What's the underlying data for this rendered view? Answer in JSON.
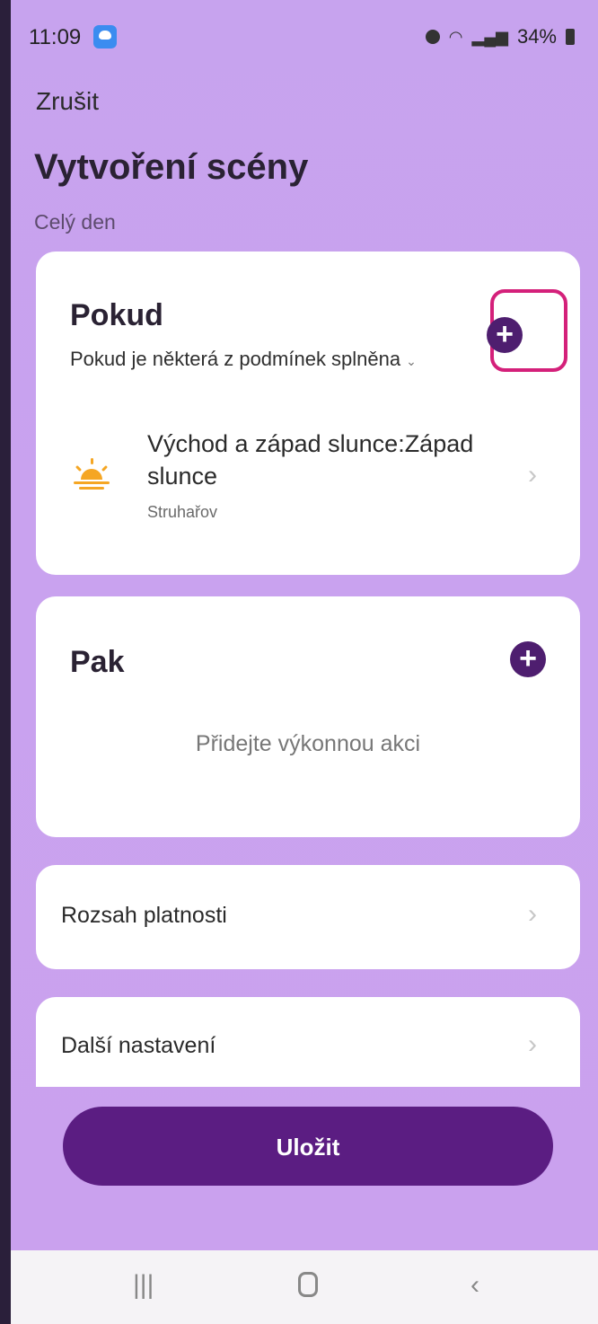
{
  "status_bar": {
    "time": "11:09",
    "battery": "34%"
  },
  "header": {
    "cancel_label": "Zrušit",
    "title": "Vytvoření scény",
    "subtitle": "Celý den"
  },
  "if_card": {
    "title": "Pokud",
    "mode": "Pokud je některá z podmínek splněna",
    "condition": {
      "title": "Východ a západ slunce:Západ slunce",
      "location": "Struhařov",
      "icon": "sunset-icon"
    }
  },
  "then_card": {
    "title": "Pak",
    "empty_text": "Přidejte výkonnou akci"
  },
  "rows": {
    "scope": "Rozsah platnosti",
    "more": "Další nastavení"
  },
  "save_label": "Uložit",
  "colors": {
    "background": "#c9a2ef",
    "accent": "#5b1d82",
    "highlight": "#d4207a",
    "sun": "#f5a623"
  }
}
